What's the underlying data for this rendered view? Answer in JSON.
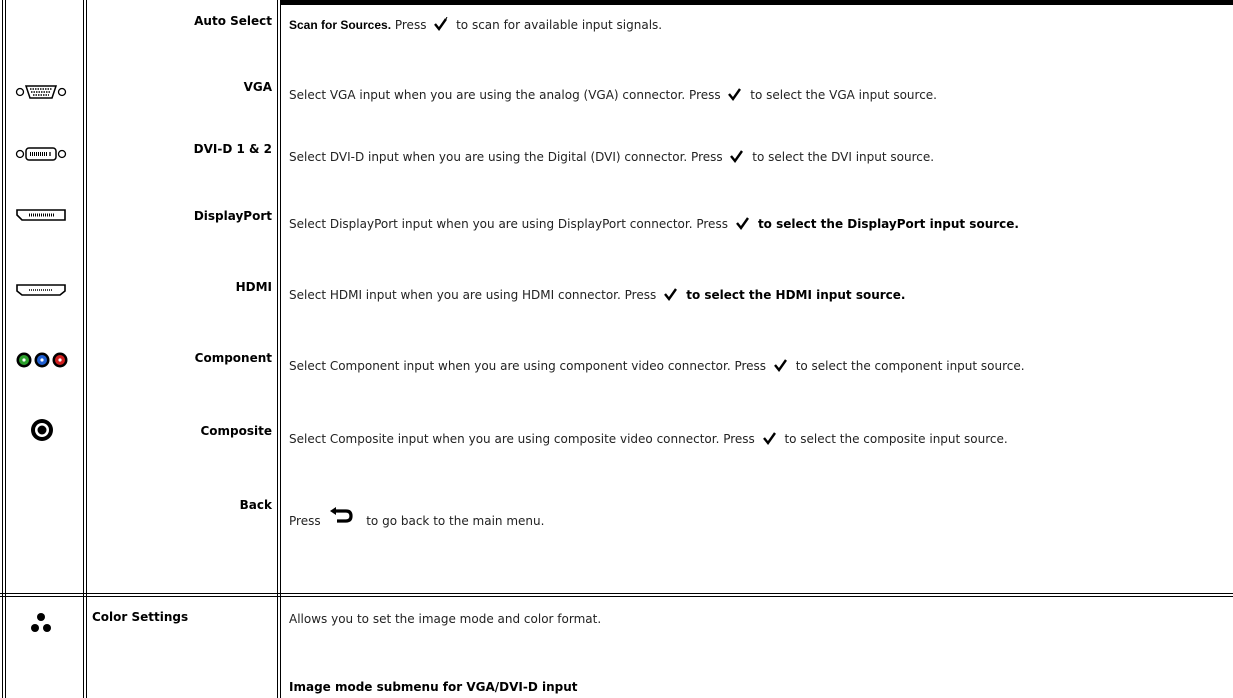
{
  "input_rows": [
    {
      "label": "Auto Select",
      "lead_bold": "Scan for Sources.",
      "pre": " Press ",
      "post": " to scan for available input signals.",
      "post_bold": ""
    },
    {
      "label": "VGA",
      "lead_bold": "",
      "pre": "Select VGA input when you are using the analog (VGA) connector. Press ",
      "post": " to select the VGA input source.",
      "post_bold": ""
    },
    {
      "label": "DVI-D 1 & 2",
      "lead_bold": "",
      "pre": "Select DVI-D input when you are using the Digital (DVI) connector. Press ",
      "post": " to select the DVI input source.",
      "post_bold": ""
    },
    {
      "label": "DisplayPort",
      "lead_bold": "",
      "pre": "Select DisplayPort input when you are using DisplayPort connector. Press ",
      "post": "",
      "post_bold": " to select the DisplayPort input source."
    },
    {
      "label": "HDMI",
      "lead_bold": "",
      "pre": "Select HDMI input when you are using HDMI connector. Press ",
      "post": "",
      "post_bold": " to select the HDMI input source."
    },
    {
      "label": "Component",
      "lead_bold": "",
      "pre": "Select Component input when you are using component video connector. Press ",
      "post": " to select the component input source.",
      "post_bold": ""
    },
    {
      "label": "Composite",
      "lead_bold": "",
      "pre": "Select Composite input when you are using composite video connector. Press ",
      "post": " to select the composite input source.",
      "post_bold": ""
    }
  ],
  "back_row": {
    "label": "Back",
    "pre": "Press ",
    "post": " to go back to the main menu."
  },
  "color_settings": {
    "label": "Color Settings",
    "description": "Allows you to set the image mode and color format.",
    "submenu_title": "Image mode submenu for VGA/DVI-D input"
  },
  "icons": [
    "vga-connector-icon",
    "dvi-connector-icon",
    "displayport-connector-icon",
    "hdmi-connector-icon",
    "component-connector-icon",
    "composite-connector-icon",
    "color-settings-icon"
  ],
  "colors": {
    "component_green": "#2ca02c",
    "component_blue": "#1f5fd1",
    "component_red": "#d11f1f"
  }
}
